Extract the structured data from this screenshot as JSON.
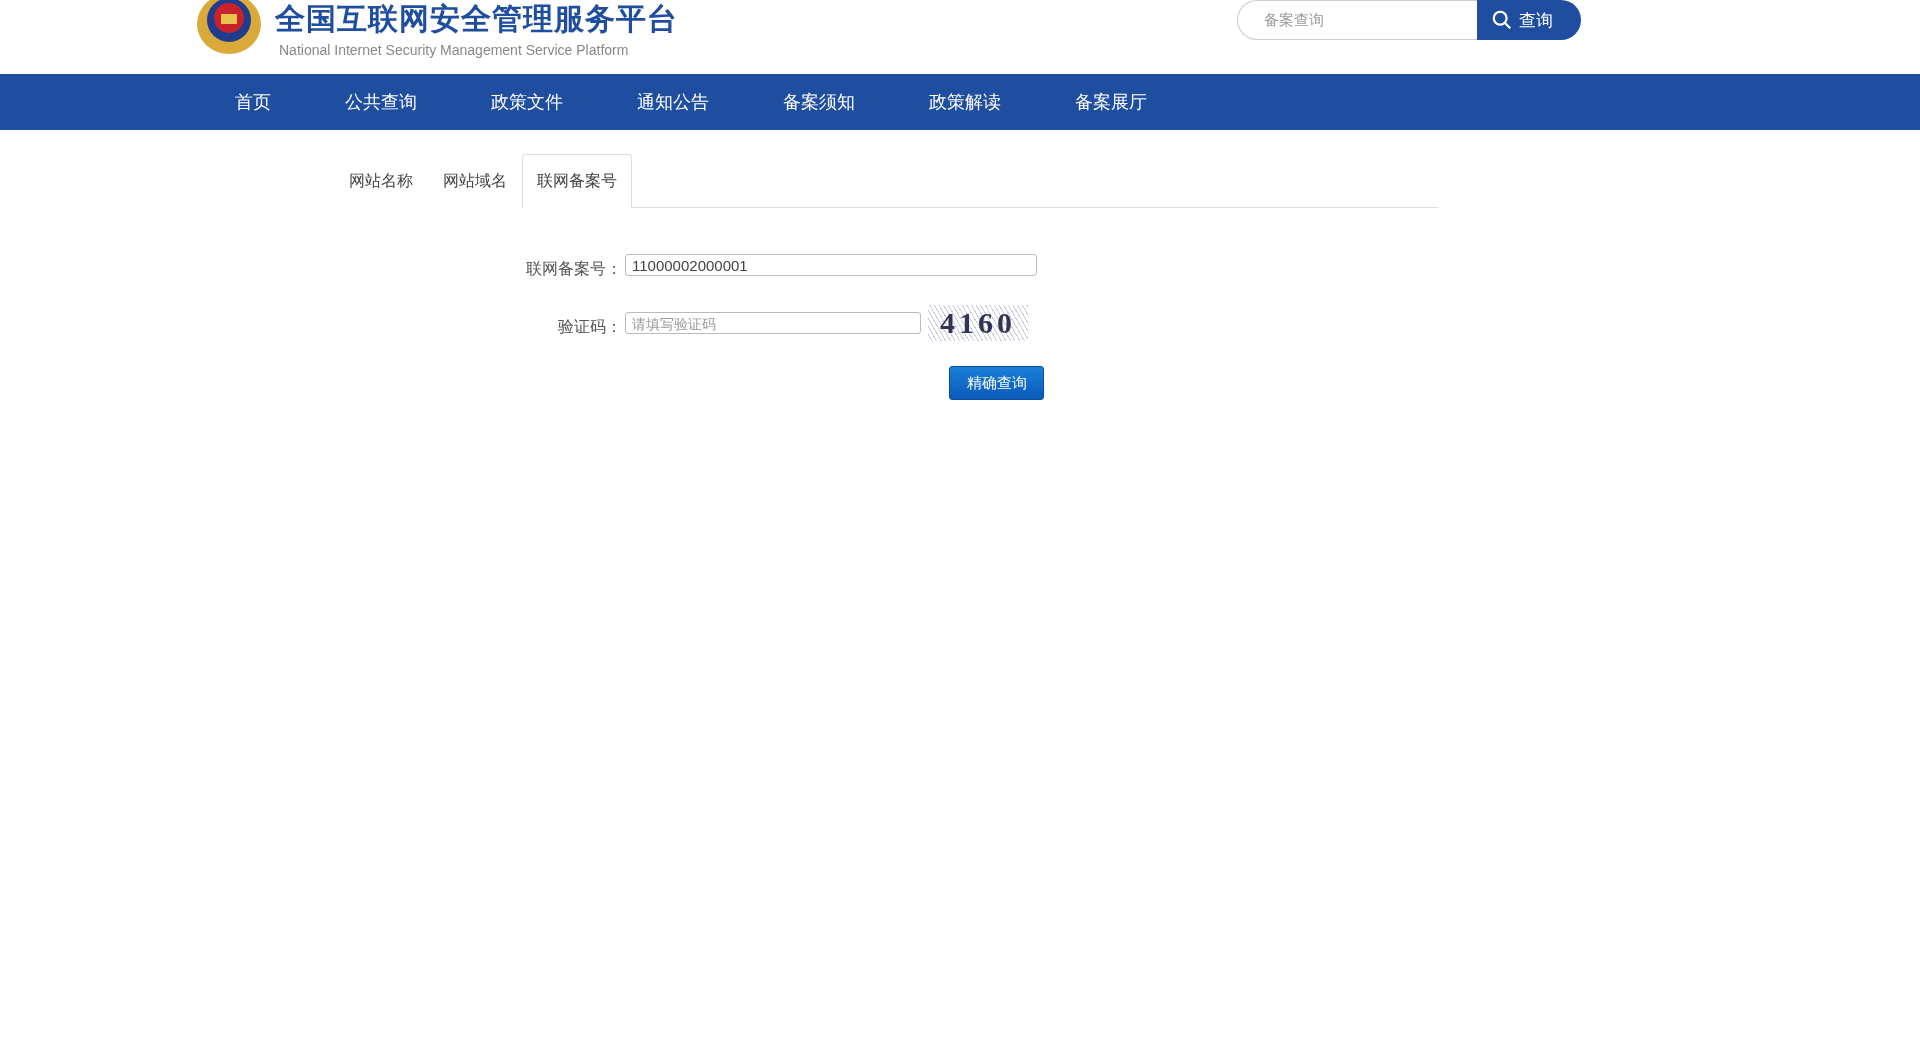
{
  "header": {
    "title": "全国互联网安全管理服务平台",
    "subtitle": "National Internet Security Management Service Platform",
    "search": {
      "placeholder": "备案查询",
      "button": "查询"
    }
  },
  "nav": [
    "首页",
    "公共查询",
    "政策文件",
    "通知公告",
    "备案须知",
    "政策解读",
    "备案展厅"
  ],
  "tabs": [
    {
      "label": "网站名称",
      "selected": false
    },
    {
      "label": "网站域名",
      "selected": false
    },
    {
      "label": "联网备案号",
      "selected": true
    }
  ],
  "form": {
    "fields": [
      {
        "kind": "text",
        "label": "联网备案号：",
        "value": "11000002000001"
      },
      {
        "kind": "captcha",
        "label": "验证码：",
        "placeholder": "请填写验证码",
        "captcha": "4160"
      }
    ],
    "submit": "精确查询"
  }
}
